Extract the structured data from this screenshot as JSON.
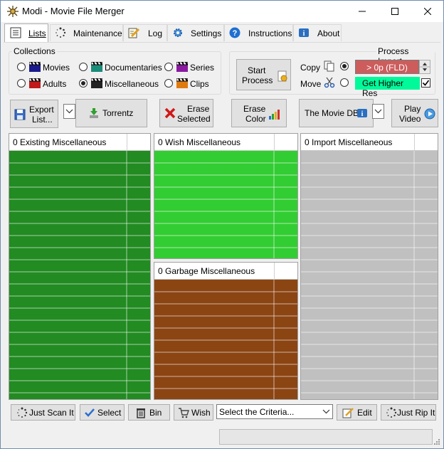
{
  "window": {
    "title": "Modi - Movie File Merger"
  },
  "tabs": [
    {
      "label": "Lists",
      "icon": "checklist-icon"
    },
    {
      "label": "Maintenance",
      "icon": "spinner-icon"
    },
    {
      "label": "Log",
      "icon": "pencil-note-icon"
    },
    {
      "label": "Settings",
      "icon": "gear-icon"
    },
    {
      "label": "Instructions",
      "icon": "help-icon"
    },
    {
      "label": "About",
      "icon": "info-icon"
    }
  ],
  "collections": {
    "title": "Collections",
    "items": [
      {
        "label": "Movies",
        "selected": false
      },
      {
        "label": "Documentaries",
        "selected": false
      },
      {
        "label": "Series",
        "selected": false
      },
      {
        "label": "Adults",
        "selected": false
      },
      {
        "label": "Miscellaneous",
        "selected": true
      },
      {
        "label": "Clips",
        "selected": false
      }
    ]
  },
  "process_import": {
    "title": "Process Import",
    "start_button": [
      "Start",
      "Process"
    ],
    "copy_label": "Copy",
    "move_label": "Move",
    "copy_selected": true,
    "move_selected": false,
    "resolution_value": "> 0p (FLD)",
    "higher_res_label": "Get Higher Res",
    "higher_res_checked": true
  },
  "toolbar": {
    "export": [
      "Export",
      "List..."
    ],
    "torrentz": "Torrentz",
    "erase_selected": [
      "Erase",
      "Selected"
    ],
    "erase_color": [
      "Erase",
      "Color"
    ],
    "moviedb": "The Movie DB",
    "play_video": [
      "Play",
      "Video"
    ]
  },
  "lists": {
    "existing": {
      "title": "0 Existing Miscellaneous",
      "color": "#228b22"
    },
    "wish": {
      "title": "0 Wish Miscellaneous",
      "color": "#32cd32"
    },
    "garbage": {
      "title": "0 Garbage Miscellaneous",
      "color": "#8b4513"
    },
    "import": {
      "title": "0 Import Miscellaneous",
      "color": "#c0c0c0"
    }
  },
  "bottom": {
    "just_scan": "Just Scan It",
    "select": "Select",
    "bin": "Bin",
    "wish": "Wish",
    "criteria_value": "Select the Criteria...",
    "edit": "Edit",
    "just_rip": "Just Rip It"
  }
}
